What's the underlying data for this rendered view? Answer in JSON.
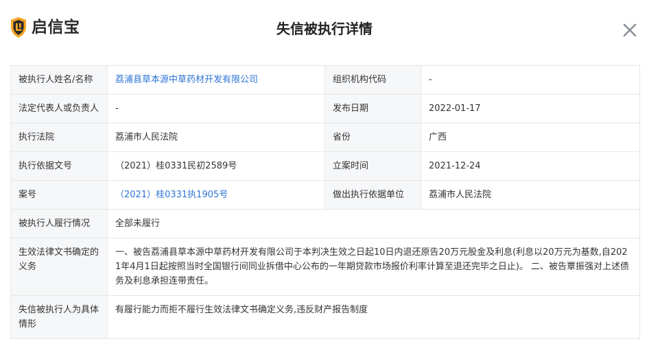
{
  "header": {
    "brand_name": "启信宝",
    "title": "失信被执行详情",
    "logo_icon": "qixinbao-shield-logo-icon",
    "close_icon": "close-icon",
    "brand_color": "#f5a623"
  },
  "details": {
    "name_label": "被执行人姓名/名称",
    "name_value": "荔浦县草本源中草药材开发有限公司",
    "org_code_label": "组织机构代码",
    "org_code_value": "-",
    "legal_rep_label": "法定代表人或负责人",
    "legal_rep_value": "-",
    "publish_date_label": "发布日期",
    "publish_date_value": "2022-01-17",
    "court_label": "执行法院",
    "court_value": "荔浦市人民法院",
    "province_label": "省份",
    "province_value": "广西",
    "basis_doc_label": "执行依据文号",
    "basis_doc_value": "（2021）桂0331民初2589号",
    "filing_date_label": "立案时间",
    "filing_date_value": "2021-12-24",
    "case_no_label": "案号",
    "case_no_value": "（2021）桂0331执1905号",
    "basis_unit_label": "做出执行依据单位",
    "basis_unit_value": "荔浦市人民法院",
    "performance_label": "被执行人履行情况",
    "performance_value": "全部未履行",
    "obligation_label": "生效法律文书确定的义务",
    "obligation_value": "一、被告荔浦县草本源中草药材开发有限公司于本判决生效之日起10日内退还原告20万元股金及利息(利息以20万元为基数,自2021年4月1日起按照当时全国银行间同业拆借中心公布的一年期贷款市场报价利率计算至退还完毕之日止)。 二、被告覃振强对上述债务及利息承担连带责任。",
    "situation_label": "失信被执行人为具体情形",
    "situation_value": "有履行能力而拒不履行生效法律文书确定义务,违反财产报告制度"
  }
}
